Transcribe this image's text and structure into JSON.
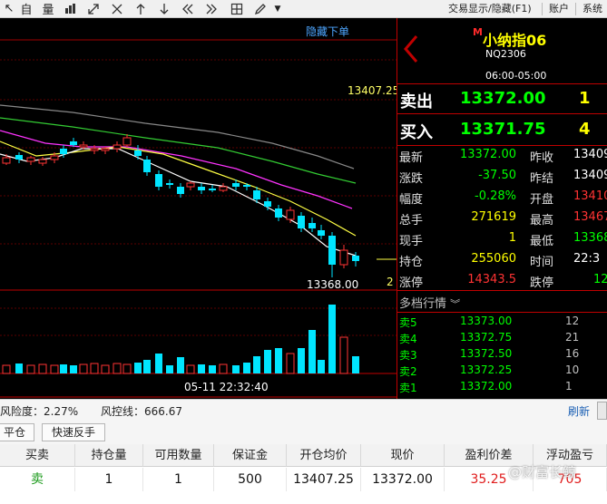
{
  "toolbar": {
    "icons": [
      "cursor-icon",
      "self-select-icon",
      "volume-icon",
      "expand-icon",
      "shrink-icon",
      "arrow-up-icon",
      "arrow-down-icon",
      "fast-back-icon",
      "fast-forward-icon",
      "grid-icon",
      "pen-icon",
      "dropdown-icon"
    ],
    "cursor_glyph": "↖",
    "zi_label": "自",
    "liang_label": "量",
    "menu_trade": "交易显示/隐藏(F1)",
    "menu_account": "账户",
    "menu_system": "系统"
  },
  "chart": {
    "hide_order": "隐藏下单",
    "price_high": "13407.25",
    "price_low": "13368.00",
    "right_mark": "2",
    "time_label": "05-11 22:32:40",
    "colors": {
      "up": "#ff3333",
      "down": "#00e5ff",
      "ma5": "#ffffff",
      "ma10": "#ffff44",
      "ma20": "#ff33ff",
      "ma40": "#33cc33",
      "ma60": "#888888"
    }
  },
  "quote": {
    "flag": "M",
    "name": "小纳指06",
    "code": "NQ2306",
    "session": "06:00-05:00",
    "sell_label": "卖出",
    "sell_price": "13372.00",
    "sell_qty": "1",
    "buy_label": "买入",
    "buy_price": "13371.75",
    "buy_qty": "4",
    "rows": [
      {
        "k1": "最新",
        "v1": "13372.00",
        "k2": "昨收",
        "v2": "13409"
      },
      {
        "k1": "涨跌",
        "v1": "-37.50",
        "k2": "昨结",
        "v2": "13409"
      },
      {
        "k1": "幅度",
        "v1": "-0.28%",
        "k2": "开盘",
        "v2": "13410"
      },
      {
        "k1": "总手",
        "v1": "271619",
        "k2": "最高",
        "v2": "13467"
      },
      {
        "k1": "现手",
        "v1": "1",
        "k2": "最低",
        "v2": "13368"
      },
      {
        "k1": "持仓",
        "v1": "255060",
        "k2": "时间",
        "v2": "22:3"
      },
      {
        "k1": "涨停",
        "v1": "14343.5",
        "k2": "跌停",
        "v2": "12"
      }
    ],
    "depth_title": "多档行情",
    "depth": [
      {
        "label": "卖5",
        "price": "13373.00",
        "qty": "12"
      },
      {
        "label": "卖4",
        "price": "13372.75",
        "qty": "21"
      },
      {
        "label": "卖3",
        "price": "13372.50",
        "qty": "16"
      },
      {
        "label": "卖2",
        "price": "13372.25",
        "qty": "10"
      },
      {
        "label": "卖1",
        "price": "13372.00",
        "qty": "1"
      }
    ]
  },
  "status": {
    "risk": "风险度：2.27%",
    "control": "风控线：666.67",
    "refresh": "刷新"
  },
  "actions": {
    "close": "平仓",
    "reverse": "快速反手"
  },
  "positions": {
    "headers": [
      "买卖",
      "持仓量",
      "可用数量",
      "保证金",
      "开仓均价",
      "现价",
      "盈利价差",
      "浮动盈亏"
    ],
    "row": [
      "卖",
      "1",
      "1",
      "500",
      "13407.25",
      "13372.00",
      "35.25",
      "705"
    ],
    "watermark": "@财富长鲸"
  }
}
